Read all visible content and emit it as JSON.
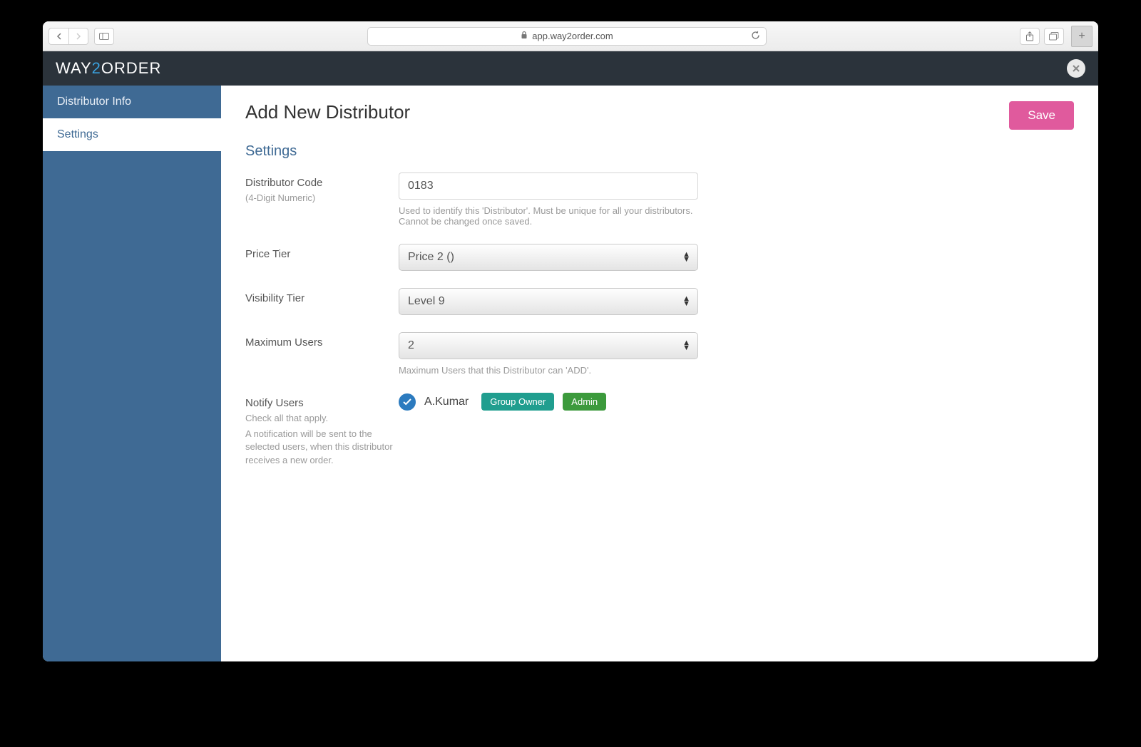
{
  "browser": {
    "url_host": "app.way2order.com"
  },
  "logo": {
    "pre": "WAY",
    "two": "2",
    "post": "ORDER"
  },
  "sidebar": {
    "items": [
      {
        "label": "Distributor Info"
      },
      {
        "label": "Settings"
      }
    ]
  },
  "page": {
    "title": "Add New Distributor",
    "save_label": "Save"
  },
  "section": {
    "title": "Settings"
  },
  "fields": {
    "code": {
      "label": "Distributor Code",
      "sublabel": "(4-Digit Numeric)",
      "value": "0183",
      "help": "Used to identify this 'Distributor'. Must be unique for all your distributors. Cannot be changed once saved."
    },
    "price_tier": {
      "label": "Price Tier",
      "value": "Price 2 ()"
    },
    "visibility_tier": {
      "label": "Visibility Tier",
      "value": "Level 9"
    },
    "max_users": {
      "label": "Maximum Users",
      "value": "2",
      "help": "Maximum Users that this Distributor can 'ADD'."
    },
    "notify": {
      "label": "Notify Users",
      "sub1": "Check all that apply.",
      "sub2": "A notification will be sent to the selected users, when this distributor receives a new order.",
      "user": "A.Kumar",
      "badge1": "Group Owner",
      "badge2": "Admin"
    }
  }
}
